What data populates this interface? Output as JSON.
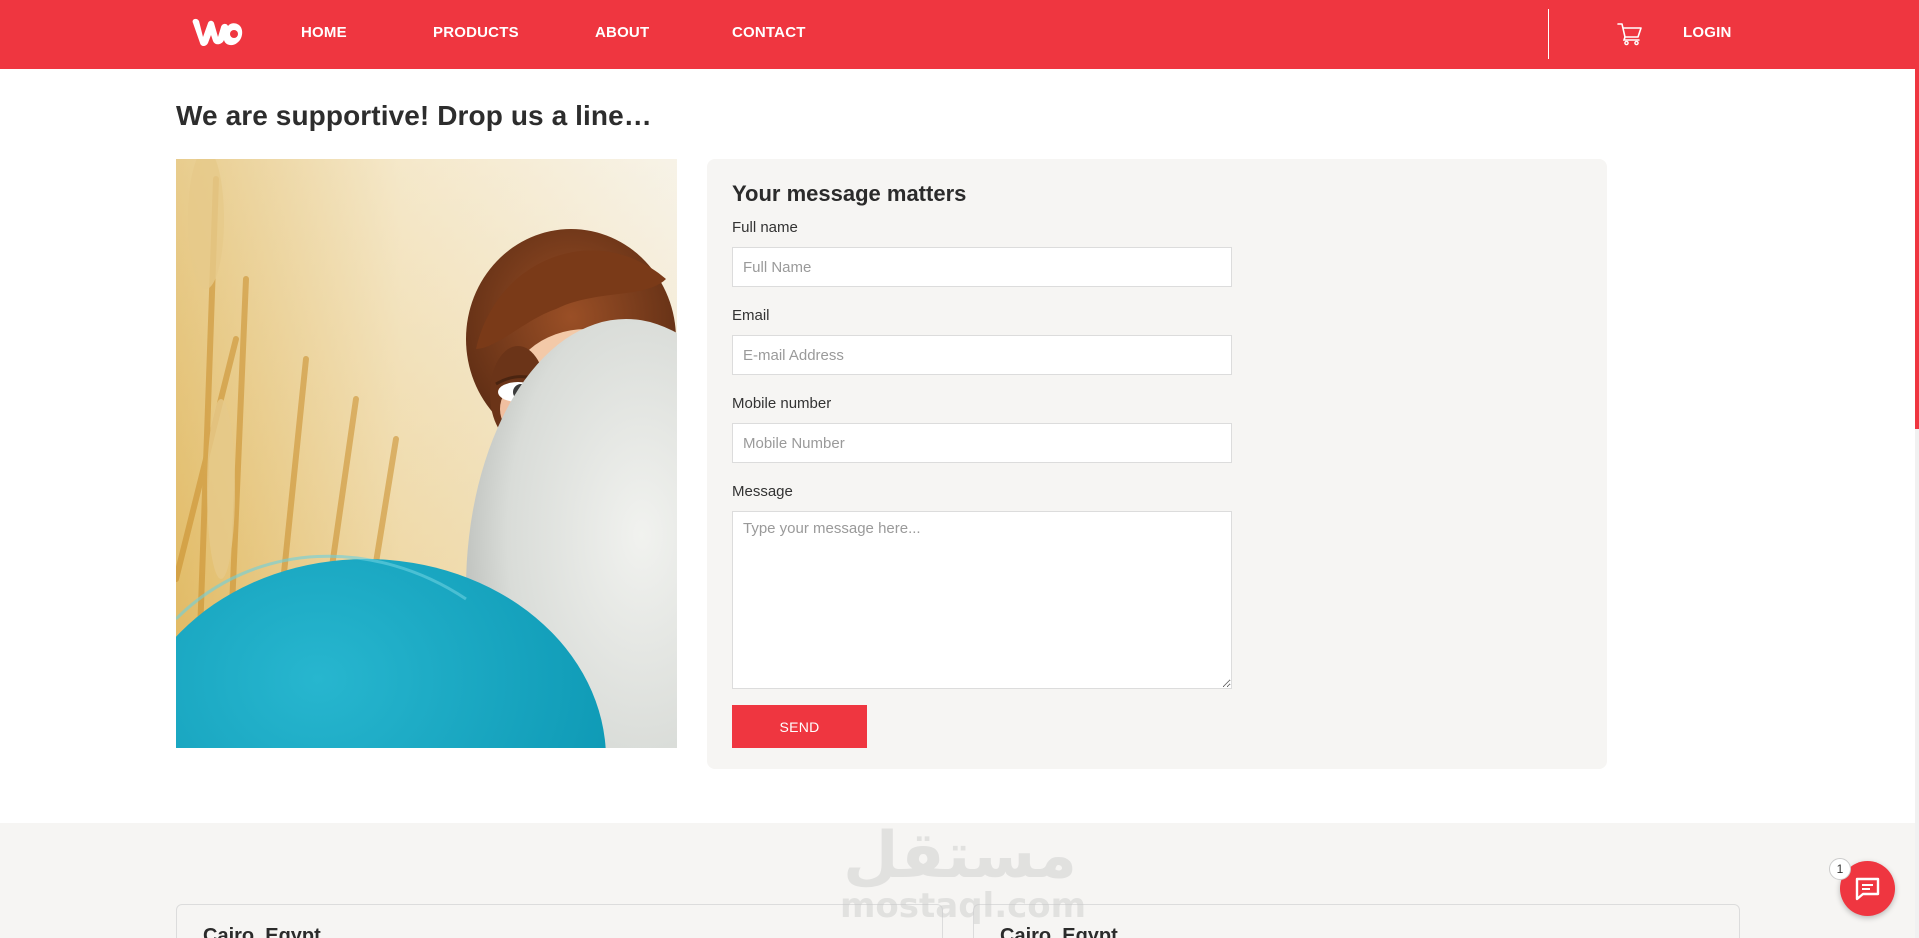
{
  "nav": {
    "links": [
      "HOME",
      "PRODUCTS",
      "ABOUT",
      "CONTACT"
    ],
    "login": "LOGIN",
    "logo_icon": "brand-logo",
    "cart_icon": "cart-icon",
    "brand_color": "#ef3640"
  },
  "main": {
    "heading": "We are supportive! Drop us a line…"
  },
  "form": {
    "title": "Your message matters",
    "full_name_label": "Full name",
    "full_name_placeholder": "Full Name",
    "email_label": "Email",
    "email_placeholder": "E-mail Address",
    "mobile_label": "Mobile number",
    "mobile_placeholder": "Mobile Number",
    "message_label": "Message",
    "message_placeholder": "Type your message here...",
    "send_label": "SEND"
  },
  "footer": {
    "locations": [
      "Cairo, Egypt",
      "Cairo, Egypt"
    ]
  },
  "watermark": {
    "arabic": "مستقل",
    "latin": "mostaql.com"
  },
  "chat": {
    "badge_count": "1",
    "icon": "chat-icon"
  }
}
